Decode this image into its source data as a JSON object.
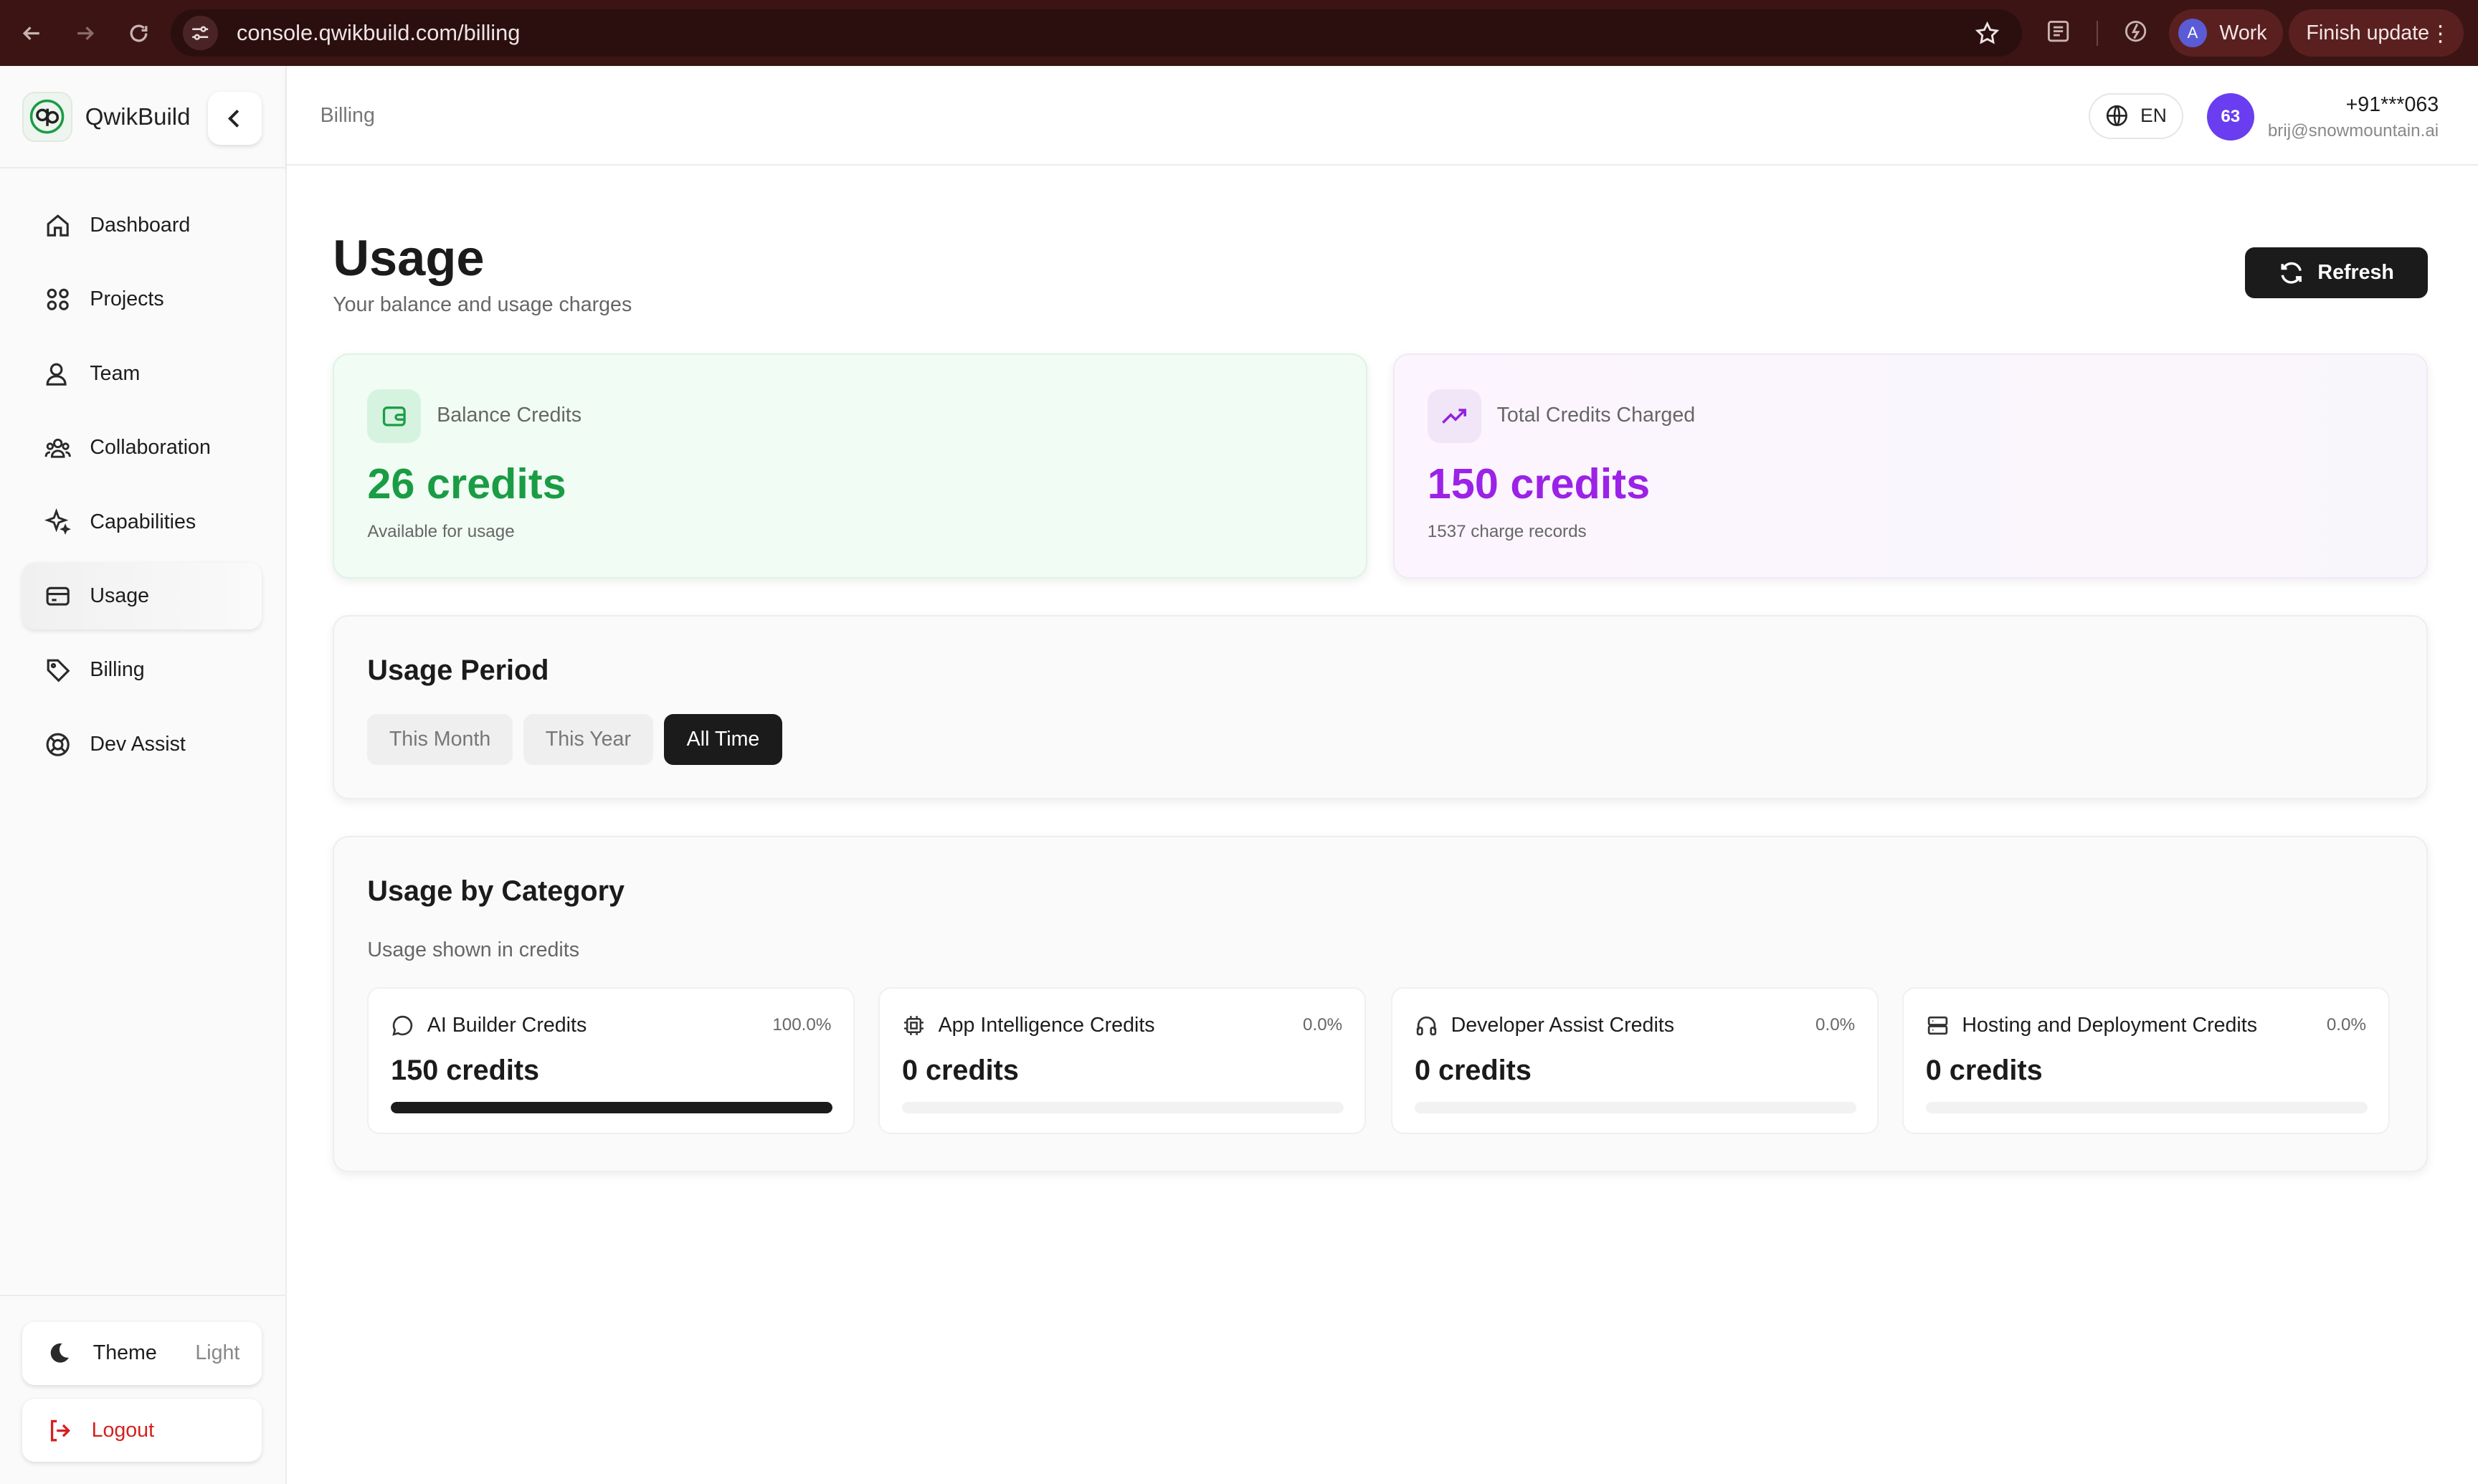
{
  "browser": {
    "url": "console.qwikbuild.com/billing",
    "profile_initial": "A",
    "profile_name": "Work",
    "update_label": "Finish update"
  },
  "brand": {
    "name": "QwikBuild",
    "accent": "#1a9c45"
  },
  "sidebar": {
    "items": [
      {
        "label": "Dashboard",
        "icon": "home-icon"
      },
      {
        "label": "Projects",
        "icon": "grid-icon"
      },
      {
        "label": "Team",
        "icon": "users-icon"
      },
      {
        "label": "Collaboration",
        "icon": "group-icon"
      },
      {
        "label": "Capabilities",
        "icon": "sparkles-icon"
      },
      {
        "label": "Usage",
        "icon": "card-icon",
        "active": true
      },
      {
        "label": "Billing",
        "icon": "tag-icon"
      },
      {
        "label": "Dev Assist",
        "icon": "lifebuoy-icon"
      }
    ],
    "theme_label": "Theme",
    "theme_value": "Light",
    "logout_label": "Logout"
  },
  "topbar": {
    "breadcrumb": "Billing",
    "language": "EN",
    "avatar_text": "63",
    "phone": "+91***063",
    "email": "brij@snowmountain.ai"
  },
  "page": {
    "title": "Usage",
    "subtitle": "Your balance and usage charges",
    "refresh_label": "Refresh"
  },
  "balance": {
    "label": "Balance Credits",
    "value": "26 credits",
    "note": "Available for usage",
    "color": "#1a9c45"
  },
  "total": {
    "label": "Total Credits Charged",
    "value": "150 credits",
    "note": "1537 charge records",
    "color": "#9b22e6"
  },
  "period": {
    "title": "Usage Period",
    "options": [
      "This Month",
      "This Year",
      "All Time"
    ],
    "selected": "All Time"
  },
  "categories": {
    "title": "Usage by Category",
    "subtitle": "Usage shown in credits",
    "items": [
      {
        "name": "AI Builder Credits",
        "icon": "chat-bubble-icon",
        "percent": "100.0%",
        "value": "150 credits",
        "fraction": 1.0
      },
      {
        "name": "App Intelligence Credits",
        "icon": "cpu-icon",
        "percent": "0.0%",
        "value": "0 credits",
        "fraction": 0.0
      },
      {
        "name": "Developer Assist Credits",
        "icon": "headphones-icon",
        "percent": "0.0%",
        "value": "0 credits",
        "fraction": 0.0
      },
      {
        "name": "Hosting and Deployment Credits",
        "icon": "server-icon",
        "percent": "0.0%",
        "value": "0 credits",
        "fraction": 0.0
      }
    ]
  }
}
